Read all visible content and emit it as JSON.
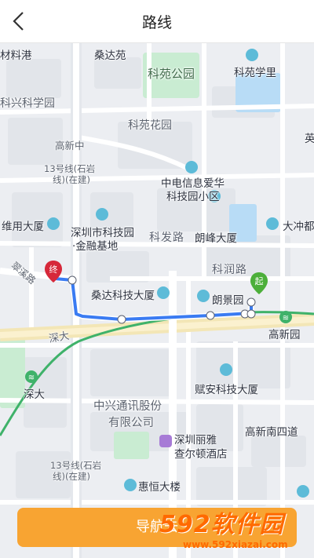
{
  "header": {
    "title": "路线",
    "back_icon": "chevron-left-icon"
  },
  "map": {
    "labels": {
      "cailiao_gang": "材料港",
      "sangda_yuan": "桑达苑",
      "keyuan_park": "科苑公园",
      "keyuan_xueli": "科苑学里",
      "kexing_science_park": "科兴科学园",
      "keyuan_huayuan": "科苑花园",
      "ying": "英",
      "gaoxin_zhong": "高新中",
      "line13_a": "13号线(石岩",
      "line13_b": "线)(在建)",
      "zhongdian_a": "中电信息爱华",
      "zhongdian_b": "科技园小区",
      "weiyong_dasha": "维用大厦",
      "sz_keji_a": "深圳市科技园",
      "sz_keji_b": "·金融基地",
      "kefa_lu": "科发路",
      "langfeng_dasha": "朗峰大厦",
      "dachong_du": "大冲都",
      "cuixi_lu": "翠溪路",
      "kerun_lu": "科润路",
      "sangda_keji": "桑达科技大厦",
      "langjing_yuan": "朗景园",
      "shenda_road": "深大",
      "gaoxin_yuan": "高新园",
      "shenda_station": "深大",
      "fuan_keji": "赋安科技大厦",
      "zte_a": "中兴通讯股份",
      "zte_b": "有限公司",
      "gaoxin_nan4": "高新南四道",
      "liya_a": "深圳丽雅",
      "liya_b": "查尔顿酒店",
      "line13_c": "13号线(石岩",
      "line13_d": "线)(在建)",
      "huiheng": "惠恒大楼"
    },
    "markers": {
      "end": "终",
      "start": "起"
    },
    "colors": {
      "route": "#3a7bf2",
      "metro": "#3fb26a",
      "main_road": "#f3e6b6",
      "park": "#c9ecd2",
      "water": "#b8dcf6"
    }
  },
  "footer": {
    "nav_button": "导航去"
  },
  "watermark": {
    "brand": "592软件园",
    "url": "www.592xiazai.com"
  }
}
